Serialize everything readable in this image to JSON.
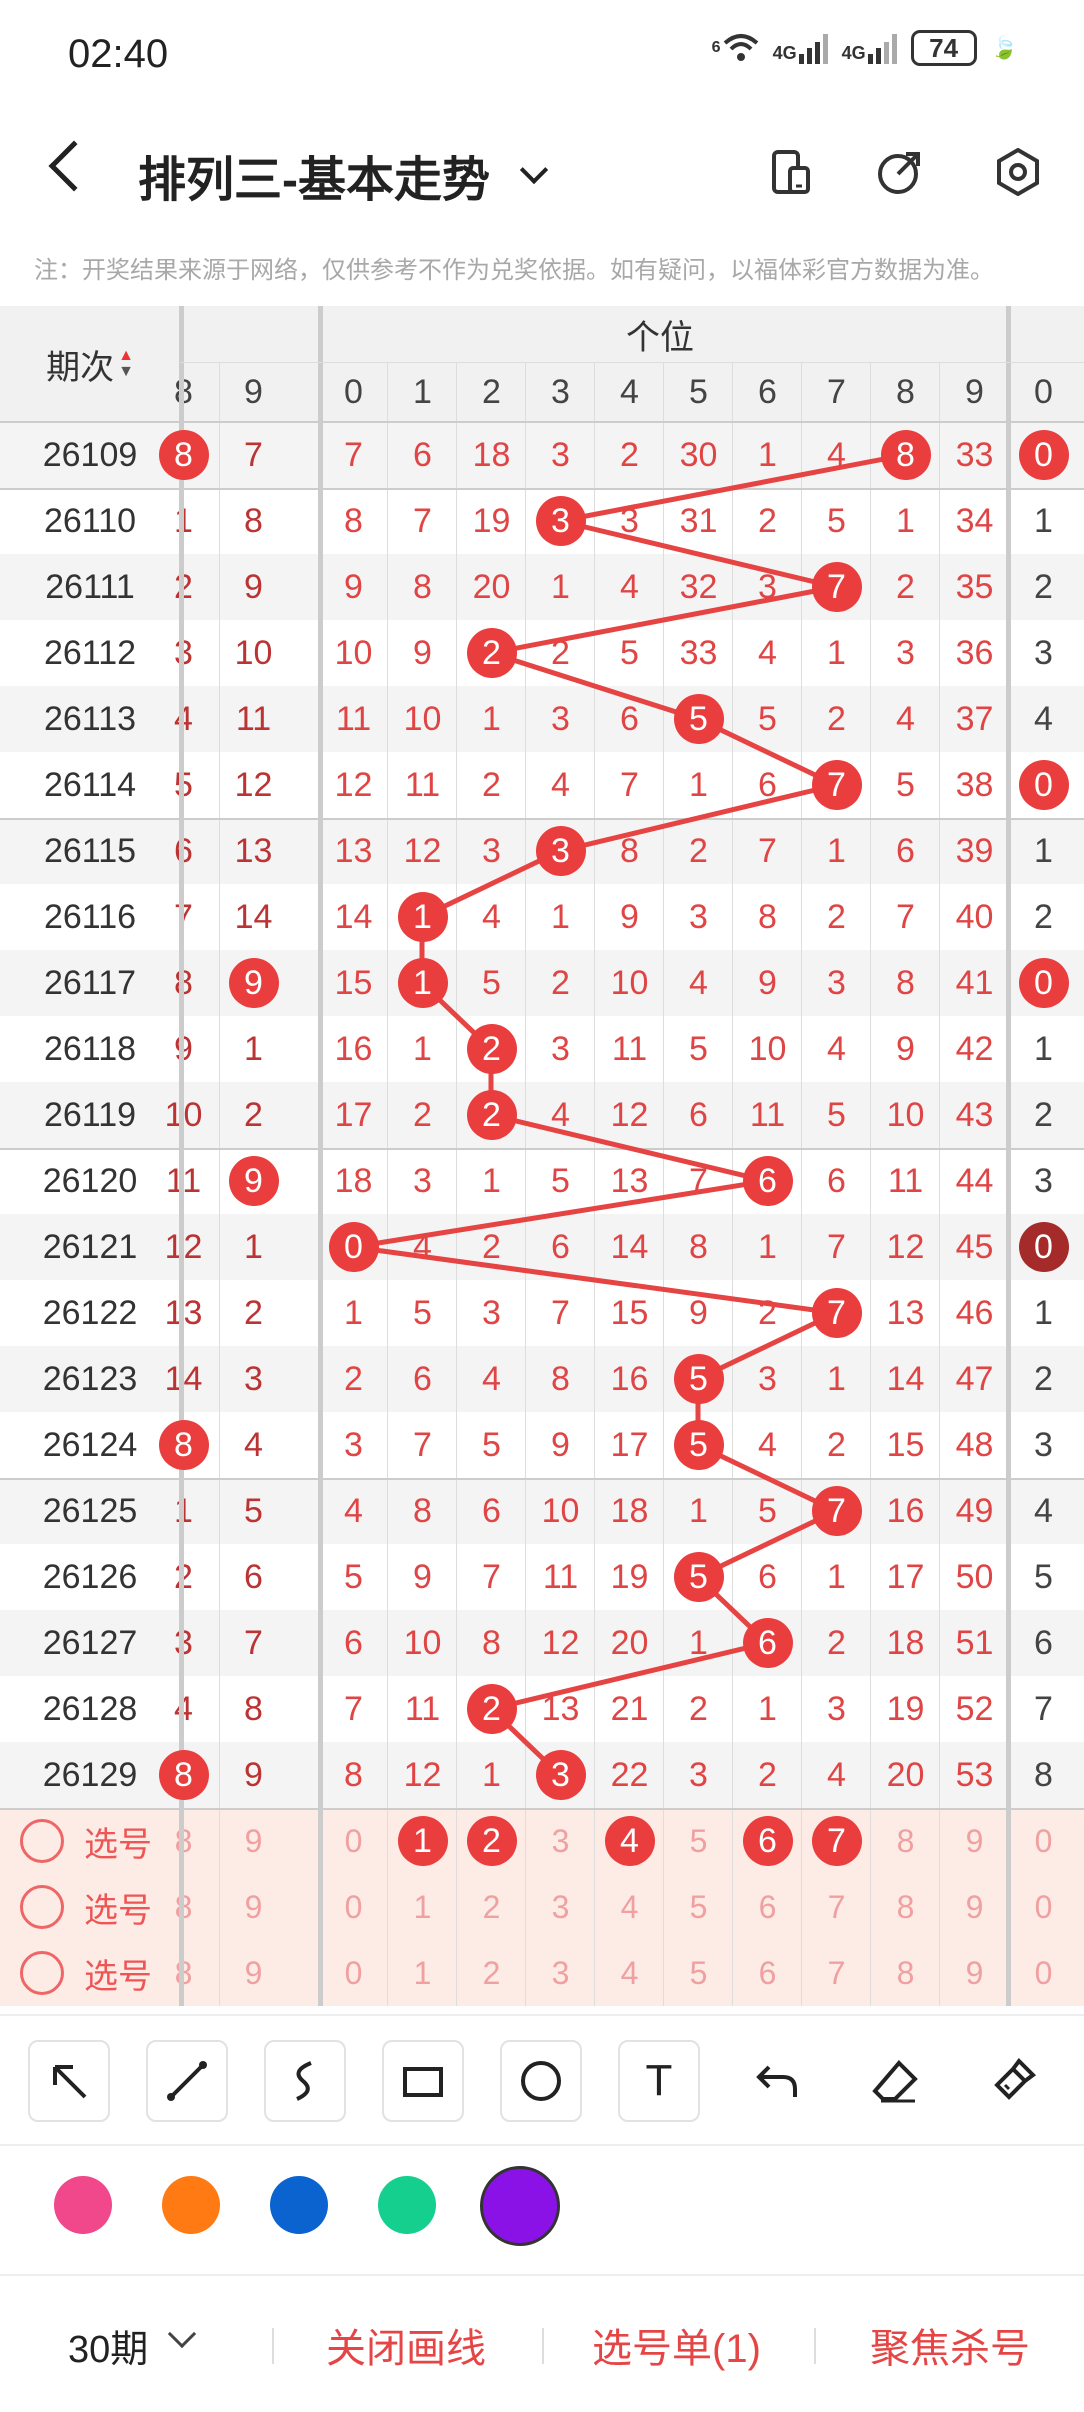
{
  "status": {
    "time": "02:40",
    "wifi": "6",
    "net1": "4G",
    "net2": "4G",
    "battery": "74"
  },
  "header": {
    "title": "排列三-基本走势"
  },
  "note": "注：开奖结果来源于网络，仅供参考不作为兑奖依据。如有疑问，以福体彩官方数据为准。",
  "table": {
    "period_header": "期次",
    "section_header": "个位",
    "left_cols": [
      "8",
      "9"
    ],
    "mid_cols": [
      "0",
      "1",
      "2",
      "3",
      "4",
      "5",
      "6",
      "7",
      "8",
      "9"
    ],
    "right_cols": [
      "0"
    ],
    "rows": [
      {
        "id": "26109",
        "left": [
          "8",
          "7"
        ],
        "left_ball": 0,
        "mid": [
          "7",
          "6",
          "18",
          "3",
          "2",
          "30",
          "1",
          "4",
          "8",
          "33"
        ],
        "ball": 8,
        "right": "0",
        "right_ball": true
      },
      {
        "id": "26110",
        "left": [
          "1",
          "8"
        ],
        "left_ball": -1,
        "mid": [
          "8",
          "7",
          "19",
          "3",
          "3",
          "31",
          "2",
          "5",
          "1",
          "34"
        ],
        "ball": 3,
        "right": "1",
        "right_ball": false
      },
      {
        "id": "26111",
        "left": [
          "2",
          "9"
        ],
        "left_ball": -1,
        "mid": [
          "9",
          "8",
          "20",
          "1",
          "4",
          "32",
          "3",
          "7",
          "2",
          "35"
        ],
        "ball": 7,
        "right": "2",
        "right_ball": false
      },
      {
        "id": "26112",
        "left": [
          "3",
          "10"
        ],
        "left_ball": -1,
        "mid": [
          "10",
          "9",
          "2",
          "2",
          "5",
          "33",
          "4",
          "1",
          "3",
          "36"
        ],
        "ball": 2,
        "right": "3",
        "right_ball": false
      },
      {
        "id": "26113",
        "left": [
          "4",
          "11"
        ],
        "left_ball": -1,
        "mid": [
          "11",
          "10",
          "1",
          "3",
          "6",
          "5",
          "5",
          "2",
          "4",
          "37"
        ],
        "ball": 5,
        "right": "4",
        "right_ball": false
      },
      {
        "id": "26114",
        "left": [
          "5",
          "12"
        ],
        "left_ball": -1,
        "mid": [
          "12",
          "11",
          "2",
          "4",
          "7",
          "1",
          "6",
          "7",
          "5",
          "38"
        ],
        "ball": 7,
        "right": "0",
        "right_ball": true
      },
      {
        "id": "26115",
        "left": [
          "6",
          "13"
        ],
        "left_ball": -1,
        "mid": [
          "13",
          "12",
          "3",
          "3",
          "8",
          "2",
          "7",
          "1",
          "6",
          "39"
        ],
        "ball": 3,
        "right": "1",
        "right_ball": false
      },
      {
        "id": "26116",
        "left": [
          "7",
          "14"
        ],
        "left_ball": -1,
        "mid": [
          "14",
          "1",
          "4",
          "1",
          "9",
          "3",
          "8",
          "2",
          "7",
          "40"
        ],
        "ball": 1,
        "right": "2",
        "right_ball": false
      },
      {
        "id": "26117",
        "left": [
          "8",
          "9"
        ],
        "left_ball": 1,
        "mid": [
          "15",
          "1",
          "5",
          "2",
          "10",
          "4",
          "9",
          "3",
          "8",
          "41"
        ],
        "ball": 1,
        "right": "0",
        "right_ball": true
      },
      {
        "id": "26118",
        "left": [
          "9",
          "1"
        ],
        "left_ball": -1,
        "mid": [
          "16",
          "1",
          "2",
          "3",
          "11",
          "5",
          "10",
          "4",
          "9",
          "42"
        ],
        "ball": 2,
        "right": "1",
        "right_ball": false
      },
      {
        "id": "26119",
        "left": [
          "10",
          "2"
        ],
        "left_ball": -1,
        "mid": [
          "17",
          "2",
          "2",
          "4",
          "12",
          "6",
          "11",
          "5",
          "10",
          "43"
        ],
        "ball": 2,
        "right": "2",
        "right_ball": false
      },
      {
        "id": "26120",
        "left": [
          "11",
          "9"
        ],
        "left_ball": 1,
        "mid": [
          "18",
          "3",
          "1",
          "5",
          "13",
          "7",
          "6",
          "6",
          "11",
          "44"
        ],
        "ball": 6,
        "right": "3",
        "right_ball": false
      },
      {
        "id": "26121",
        "left": [
          "12",
          "1"
        ],
        "left_ball": -1,
        "mid": [
          "0",
          "4",
          "2",
          "6",
          "14",
          "8",
          "1",
          "7",
          "12",
          "45"
        ],
        "ball": 0,
        "right": "0",
        "right_ball": true,
        "right_dark": true
      },
      {
        "id": "26122",
        "left": [
          "13",
          "2"
        ],
        "left_ball": -1,
        "mid": [
          "1",
          "5",
          "3",
          "7",
          "15",
          "9",
          "2",
          "7",
          "13",
          "46"
        ],
        "ball": 7,
        "right": "1",
        "right_ball": false
      },
      {
        "id": "26123",
        "left": [
          "14",
          "3"
        ],
        "left_ball": -1,
        "mid": [
          "2",
          "6",
          "4",
          "8",
          "16",
          "5",
          "3",
          "1",
          "14",
          "47"
        ],
        "ball": 5,
        "right": "2",
        "right_ball": false
      },
      {
        "id": "26124",
        "left": [
          "8",
          "4"
        ],
        "left_ball": 0,
        "mid": [
          "3",
          "7",
          "5",
          "9",
          "17",
          "5",
          "4",
          "2",
          "15",
          "48"
        ],
        "ball": 5,
        "right": "3",
        "right_ball": false
      },
      {
        "id": "26125",
        "left": [
          "1",
          "5"
        ],
        "left_ball": -1,
        "mid": [
          "4",
          "8",
          "6",
          "10",
          "18",
          "1",
          "5",
          "7",
          "16",
          "49"
        ],
        "ball": 7,
        "right": "4",
        "right_ball": false
      },
      {
        "id": "26126",
        "left": [
          "2",
          "6"
        ],
        "left_ball": -1,
        "mid": [
          "5",
          "9",
          "7",
          "11",
          "19",
          "5",
          "6",
          "1",
          "17",
          "50"
        ],
        "ball": 5,
        "right": "5",
        "right_ball": false
      },
      {
        "id": "26127",
        "left": [
          "3",
          "7"
        ],
        "left_ball": -1,
        "mid": [
          "6",
          "10",
          "8",
          "12",
          "20",
          "1",
          "6",
          "2",
          "18",
          "51"
        ],
        "ball": 6,
        "right": "6",
        "right_ball": false
      },
      {
        "id": "26128",
        "left": [
          "4",
          "8"
        ],
        "left_ball": -1,
        "mid": [
          "7",
          "11",
          "2",
          "13",
          "21",
          "2",
          "1",
          "3",
          "19",
          "52"
        ],
        "ball": 2,
        "right": "7",
        "right_ball": false
      },
      {
        "id": "26129",
        "left": [
          "8",
          "9"
        ],
        "left_ball": 0,
        "mid": [
          "8",
          "12",
          "1",
          "3",
          "22",
          "3",
          "2",
          "4",
          "20",
          "53"
        ],
        "ball": 3,
        "right": "8",
        "right_ball": false
      }
    ],
    "select_rows": [
      {
        "label": "选号",
        "left": [
          "8",
          "9"
        ],
        "mid": [
          "0",
          "1",
          "2",
          "3",
          "4",
          "5",
          "6",
          "7",
          "8",
          "9"
        ],
        "right": "0",
        "selected": [
          1,
          2,
          4,
          6,
          7
        ]
      },
      {
        "label": "选号",
        "left": [
          "8",
          "9"
        ],
        "mid": [
          "0",
          "1",
          "2",
          "3",
          "4",
          "5",
          "6",
          "7",
          "8",
          "9"
        ],
        "right": "0",
        "selected": []
      },
      {
        "label": "选号",
        "left": [
          "8",
          "9"
        ],
        "mid": [
          "0",
          "1",
          "2",
          "3",
          "4",
          "5",
          "6",
          "7",
          "8",
          "9"
        ],
        "right": "0",
        "selected": []
      }
    ]
  },
  "tools": [
    "arrow-tool",
    "line-tool",
    "curve-tool",
    "rectangle-tool",
    "circle-tool",
    "text-tool",
    "undo-tool",
    "eraser-tool",
    "clear-tool"
  ],
  "tool_glyphs": {
    "text": "T"
  },
  "colors": [
    "#f0488a",
    "#ff7a12",
    "#0a63cf",
    "#15cf8f",
    "#8a12e6"
  ],
  "selected_color": "#8a12e6",
  "bottom": {
    "period": "30期",
    "close_lines": "关闭画线",
    "selection_list": "选号单(1)",
    "focus_kill": "聚焦杀号"
  }
}
